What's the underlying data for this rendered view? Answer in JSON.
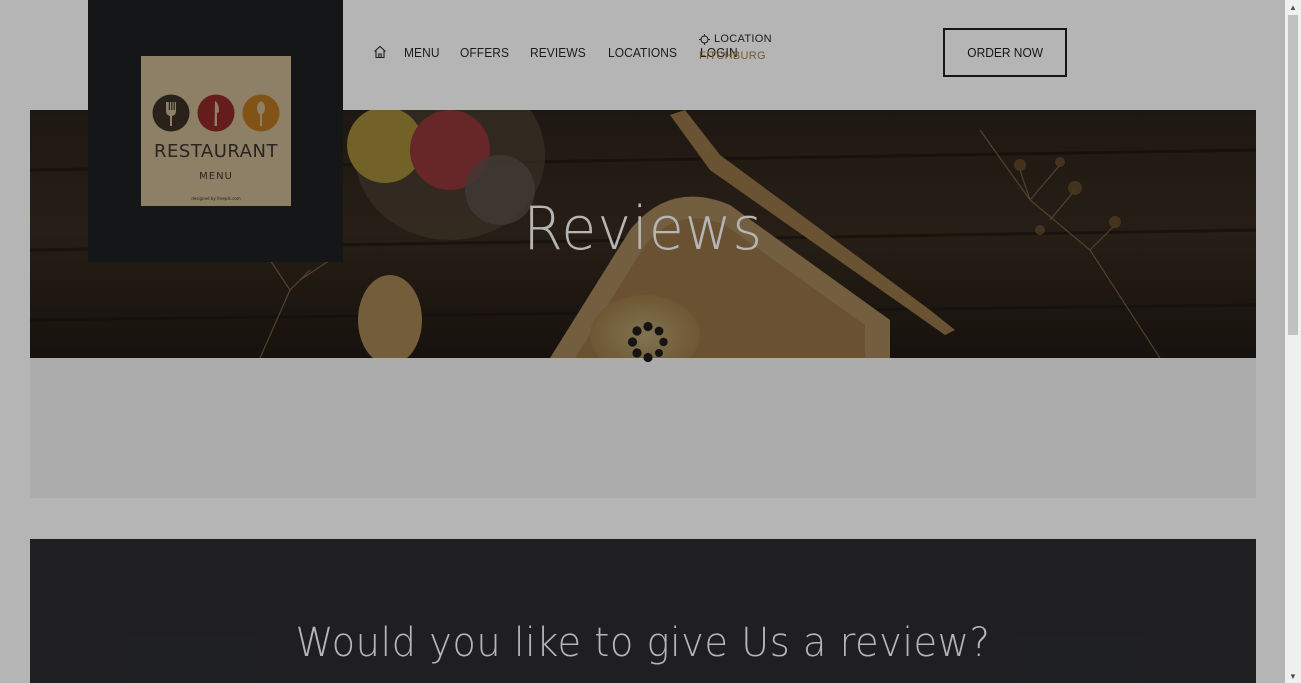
{
  "logo": {
    "title": "RESTAURANT",
    "subtitle": "MENU",
    "credit": "designed by freepik.com",
    "circle_colors": [
      "#3b3125",
      "#8e2a26",
      "#b7761f"
    ],
    "icons": [
      "fork-icon",
      "knife-icon",
      "spoon-icon"
    ]
  },
  "nav": {
    "home_icon": "home-icon",
    "items": [
      {
        "label": "MENU"
      },
      {
        "label": "OFFERS"
      },
      {
        "label": "REVIEWS"
      },
      {
        "label": "LOCATIONS"
      },
      {
        "label": "LOGIN"
      }
    ],
    "location_label": "LOCATION",
    "location_icon": "crosshair-icon",
    "location_city": "FITCHBURG"
  },
  "order_button": {
    "label": "ORDER NOW"
  },
  "hero": {
    "title": "Reviews"
  },
  "review_section": {
    "heading": "Would you like to give Us a review?"
  },
  "loading": {
    "icon": "loading-spinner-icon"
  },
  "colors": {
    "accent": "#a57a3c",
    "dark": "#1e1f21",
    "overlay": "rgba(0,0,0,0.29)"
  }
}
